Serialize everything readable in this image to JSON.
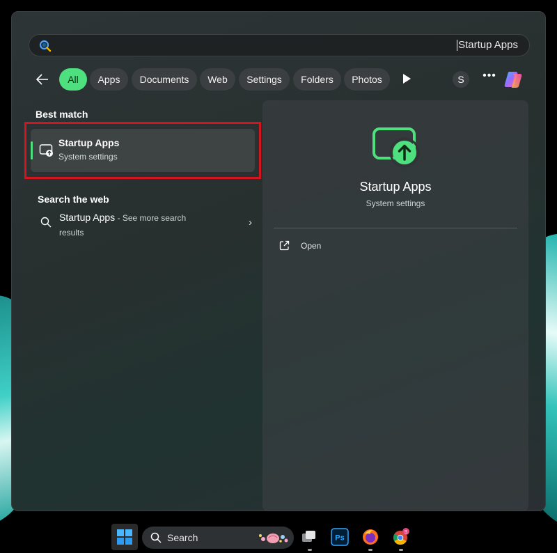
{
  "search": {
    "value": "Startup Apps"
  },
  "filters": {
    "chips": [
      "All",
      "Apps",
      "Documents",
      "Web",
      "Settings",
      "Folders",
      "Photos"
    ],
    "active": "All",
    "avatar_letter": "S",
    "more_label": "•••"
  },
  "best_match": {
    "heading": "Best match",
    "title": "Startup Apps",
    "subtitle": "System settings"
  },
  "web": {
    "heading": "Search the web",
    "query": "Startup Apps",
    "suffix": " - See more search results",
    "chevron": "›"
  },
  "preview": {
    "title": "Startup Apps",
    "subtitle": "System settings",
    "open_label": "Open"
  },
  "taskbar": {
    "search_label": "Search",
    "ps_label": "Ps",
    "chrome_badge": "S"
  },
  "colors": {
    "accent_green": "#4ee07f",
    "highlight_red": "#d4151f"
  },
  "icons": [
    "search-icon",
    "back-arrow-icon",
    "play-icon",
    "copilot-icon",
    "startup-apps-icon",
    "open-external-icon",
    "windows-logo-icon",
    "task-view-icon",
    "photoshop-icon",
    "firefox-icon",
    "chrome-icon"
  ]
}
